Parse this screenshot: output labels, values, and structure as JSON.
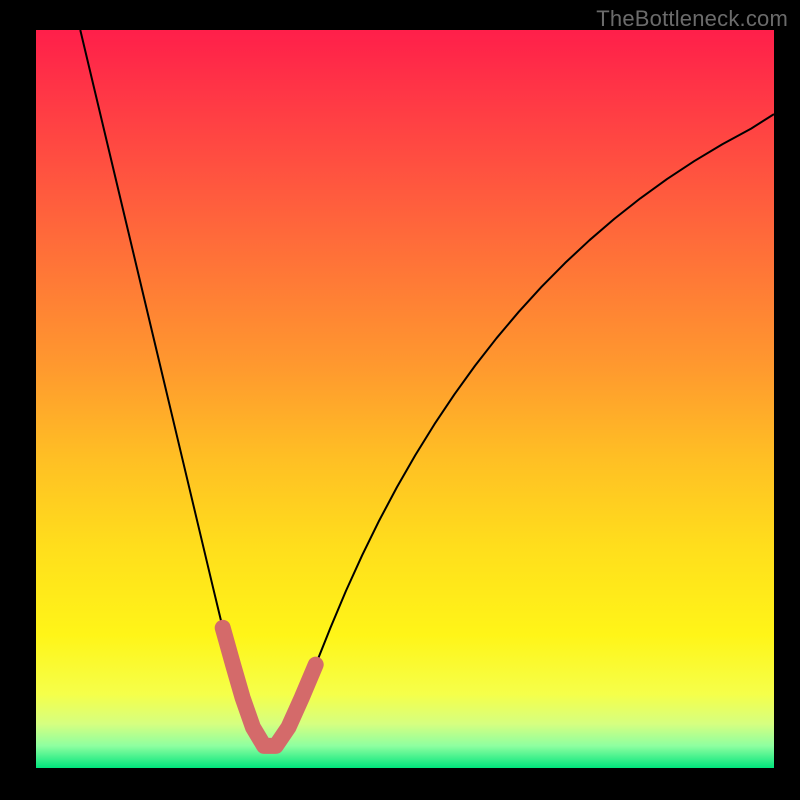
{
  "watermark": "TheBottleneck.com",
  "chart_data": {
    "type": "line",
    "title": "",
    "xlabel": "",
    "ylabel": "",
    "xlim": [
      0,
      100
    ],
    "ylim": [
      0,
      100
    ],
    "grid": false,
    "series": [
      {
        "name": "bottleneck-curve",
        "color": "#000000",
        "stroke_width": 2,
        "x": [
          6,
          8,
          10,
          12,
          14,
          16,
          18,
          20,
          22,
          24,
          25.3,
          26.7,
          28,
          29.4,
          30.9,
          32.5,
          34.2,
          36,
          37.9,
          39.9,
          42,
          44.2,
          46.5,
          48.9,
          51.4,
          54,
          56.7,
          59.5,
          62.4,
          65.4,
          68.5,
          71.7,
          75,
          78.4,
          81.9,
          85.5,
          89.2,
          93,
          96.9,
          100
        ],
        "y": [
          100,
          91.6,
          83.2,
          74.8,
          66.4,
          58,
          49.6,
          41.2,
          32.8,
          24.4,
          19,
          14,
          9.5,
          5.5,
          3,
          3,
          5.5,
          9.5,
          14,
          19,
          24,
          28.84,
          33.52,
          38.04,
          42.4,
          46.6,
          50.64,
          54.52,
          58.24,
          61.8,
          65.2,
          68.44,
          71.52,
          74.44,
          77.2,
          79.8,
          82.24,
          84.52,
          86.64,
          88.6
        ]
      },
      {
        "name": "minimum-marker",
        "color": "#d46a6a",
        "stroke_width": 16,
        "linecap": "round",
        "x": [
          25.3,
          26.7,
          28,
          29.4,
          30.9,
          32.5,
          34.2,
          36,
          37.9
        ],
        "y": [
          19,
          14,
          9.5,
          5.5,
          3,
          3,
          5.5,
          9.5,
          14
        ]
      }
    ]
  }
}
